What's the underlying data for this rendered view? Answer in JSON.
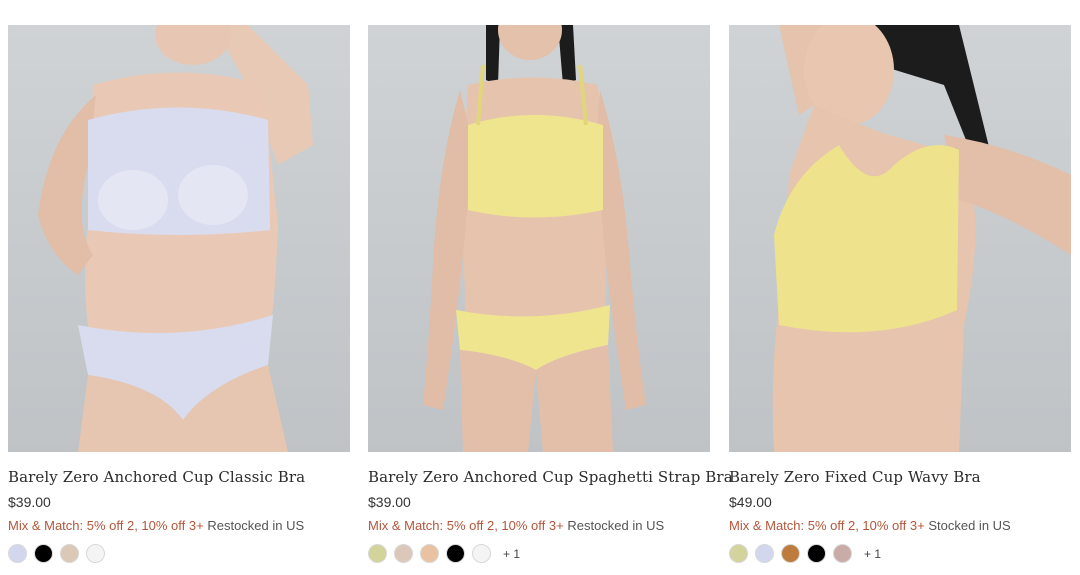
{
  "products": [
    {
      "name": "Barely Zero Anchored Cup Classic Bra",
      "price": "$39.00",
      "promo": "Mix & Match: 5% off 2, 10% off 3+",
      "stock": "Restocked in US",
      "image_alt": "Model wearing lavender bra and brief",
      "garment_color": "#d9dcef",
      "swatches": [
        "#d3d7ee",
        "#000000",
        "#dcc8b6",
        "#f4f4f4"
      ],
      "more": ""
    },
    {
      "name": "Barely Zero Anchored Cup Spaghetti Strap Bra",
      "price": "$39.00",
      "promo": "Mix & Match: 5% off 2, 10% off 3+",
      "stock": "Restocked in US",
      "image_alt": "Model wearing yellow spaghetti strap bra and brief",
      "garment_color": "#efe58f",
      "swatches": [
        "#d3d39c",
        "#dcc8bb",
        "#e9c3a1",
        "#000000",
        "#f4f4f4"
      ],
      "more": "+ 1"
    },
    {
      "name": "Barely Zero Fixed Cup Wavy Bra",
      "price": "$49.00",
      "promo": "Mix & Match: 5% off 2, 10% off 3+",
      "stock": "Stocked in US",
      "image_alt": "Close-up of model wearing yellow wavy bra",
      "garment_color": "#eee28d",
      "swatches": [
        "#d3d39c",
        "#d3d7ee",
        "#bd7c3e",
        "#000000",
        "#c9aba7"
      ],
      "more": "+ 1"
    }
  ]
}
